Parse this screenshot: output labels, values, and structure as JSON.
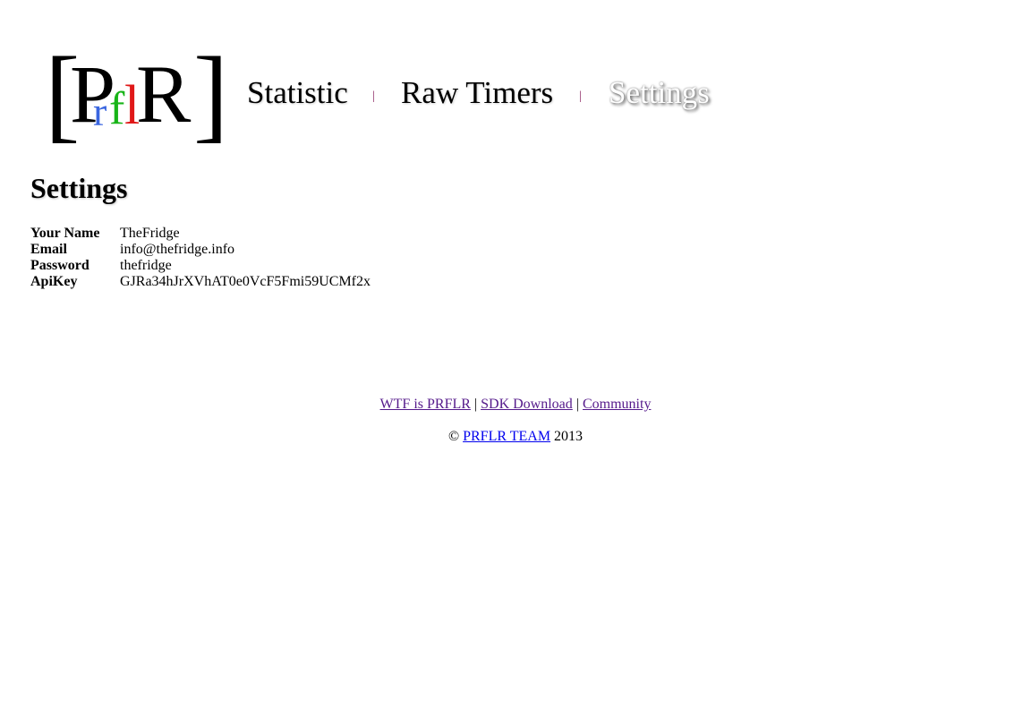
{
  "logo": {
    "left_bracket": "[",
    "p": "P",
    "r": "r",
    "f": "f",
    "l": "l",
    "big_r": "R",
    "right_bracket": "]",
    "colors": {
      "r": "#3a66e0",
      "f": "#18b418",
      "l": "#e01818",
      "main": "#000000"
    }
  },
  "nav": {
    "items": [
      {
        "label": "Statistic"
      },
      {
        "label": "Raw Timers"
      },
      {
        "label": "Settings"
      }
    ],
    "separator": "|"
  },
  "page": {
    "title": "Settings"
  },
  "settings": {
    "rows": [
      {
        "key": "Your Name",
        "value": "TheFridge"
      },
      {
        "key": "Email",
        "value": "info@thefridge.info"
      },
      {
        "key": "Password",
        "value": "thefridge"
      },
      {
        "key": "ApiKey",
        "value": "GJRa34hJrXVhAT0e0VcF5Fmi59UCMf2x"
      }
    ]
  },
  "footer": {
    "links": [
      {
        "label": "WTF is PRFLR"
      },
      {
        "label": "SDK Download"
      },
      {
        "label": "Community"
      }
    ],
    "separator": "|",
    "copyright_symbol": "©",
    "team_link": "PRFLR TEAM",
    "year": "2013"
  }
}
